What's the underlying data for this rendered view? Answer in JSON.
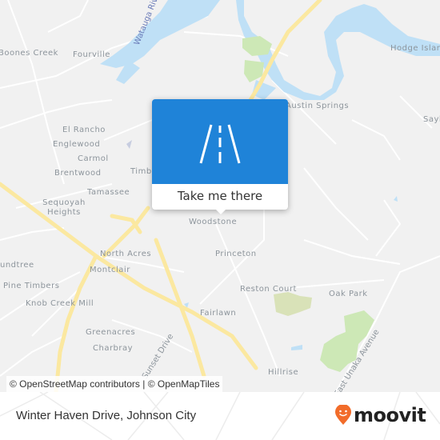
{
  "map": {
    "places": [
      {
        "name": "Boones Creek"
      },
      {
        "name": "Fourville"
      },
      {
        "name": "Austin Springs"
      },
      {
        "name": "Hodge Island"
      },
      {
        "name": "Sayl"
      },
      {
        "name": "El Rancho"
      },
      {
        "name": "Englewood"
      },
      {
        "name": "Carmol"
      },
      {
        "name": "Brentwood"
      },
      {
        "name": "Timb"
      },
      {
        "name": "Tamassee"
      },
      {
        "name": "Sequoyah Heights"
      },
      {
        "name": "Woodstone"
      },
      {
        "name": "undtree"
      },
      {
        "name": "North Acres"
      },
      {
        "name": "Montclair"
      },
      {
        "name": "Princeton"
      },
      {
        "name": "Pine Timbers"
      },
      {
        "name": "Knob Creek Mill"
      },
      {
        "name": "Reston Court"
      },
      {
        "name": "Oak Park"
      },
      {
        "name": "Fairlawn"
      },
      {
        "name": "Greenacres"
      },
      {
        "name": "Charbray"
      },
      {
        "name": "Hillrise"
      }
    ],
    "water_labels": [
      "Watauga River"
    ],
    "road_labels": [
      "Sunset Drive",
      "East Unaka Avenue"
    ],
    "attribution": "© OpenStreetMap contributors | © OpenMapTiles",
    "colors": {
      "background": "#f1f1f1",
      "water": "#bfe0f6",
      "park": "#cde8b6",
      "highway": "#fbe8a0",
      "road": "#ffffff",
      "popup_accent": "#1f83d8",
      "brand_orange": "#f26c2a"
    }
  },
  "popup": {
    "icon": "road-icon",
    "action_label": "Take me there"
  },
  "footer": {
    "location_title": "Winter Haven Drive, Johnson City",
    "brand_name": "moovit",
    "brand_icon": "moovit-pin-icon"
  }
}
